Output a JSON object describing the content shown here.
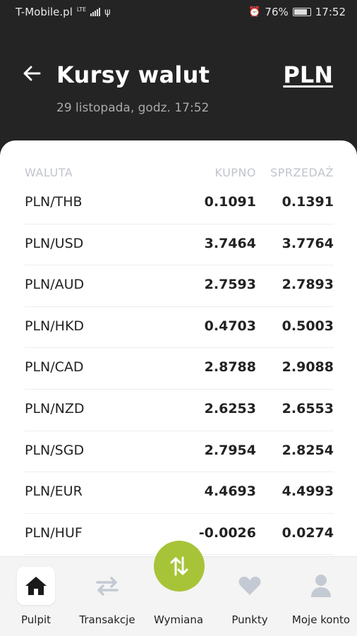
{
  "status_bar": {
    "carrier": "T-Mobile.pl",
    "network": "LTE",
    "battery": "76%",
    "time": "17:52"
  },
  "header": {
    "title": "Kursy walut",
    "currency": "PLN",
    "subtitle": "29 listopada, godz. 17:52"
  },
  "table": {
    "headers": {
      "currency": "WALUTA",
      "buy": "KUPNO",
      "sell": "SPRZEDAŻ"
    },
    "rows": [
      {
        "pair": "PLN/THB",
        "buy": "0.1091",
        "sell": "0.1391"
      },
      {
        "pair": "PLN/USD",
        "buy": "3.7464",
        "sell": "3.7764"
      },
      {
        "pair": "PLN/AUD",
        "buy": "2.7593",
        "sell": "2.7893"
      },
      {
        "pair": "PLN/HKD",
        "buy": "0.4703",
        "sell": "0.5003"
      },
      {
        "pair": "PLN/CAD",
        "buy": "2.8788",
        "sell": "2.9088"
      },
      {
        "pair": "PLN/NZD",
        "buy": "2.6253",
        "sell": "2.6553"
      },
      {
        "pair": "PLN/SGD",
        "buy": "2.7954",
        "sell": "2.8254"
      },
      {
        "pair": "PLN/EUR",
        "buy": "4.4693",
        "sell": "4.4993"
      },
      {
        "pair": "PLN/HUF",
        "buy": "-0.0026",
        "sell": "0.0274"
      }
    ]
  },
  "nav": {
    "items": [
      {
        "label": "Pulpit",
        "icon": "home-icon",
        "active": true
      },
      {
        "label": "Transakcje",
        "icon": "transfer-arrows-icon"
      },
      {
        "label": "Wymiana",
        "icon": "exchange-icon"
      },
      {
        "label": "Punkty",
        "icon": "heart-icon"
      },
      {
        "label": "Moje konto",
        "icon": "user-icon"
      }
    ]
  },
  "colors": {
    "header_bg": "#242424",
    "accent": "#a7c438",
    "nav_icon_inactive": "#c4cad3"
  }
}
